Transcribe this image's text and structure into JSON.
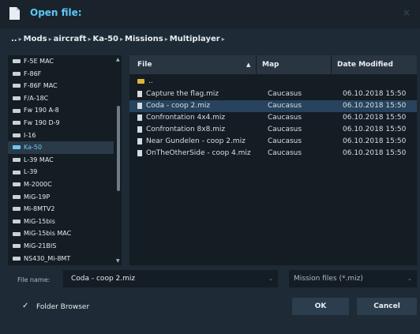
{
  "window": {
    "title": "Open file:",
    "close_glyph": "×",
    "icon": "file-icon",
    "accent_color": "#5cc8f8"
  },
  "breadcrumb": {
    "root": "..",
    "segments": [
      "Mods",
      "aircraft",
      "Ka-50",
      "Missions",
      "Multiplayer"
    ],
    "separator": "▸"
  },
  "left_list": {
    "items": [
      "F-5E MAC",
      "F-86F",
      "F-86F MAC",
      "F/A-18C",
      "Fw 190 A-8",
      "Fw 190 D-9",
      "I-16",
      "Ka-50",
      "L-39 MAC",
      "L-39",
      "M-2000C",
      "MiG-19P",
      "Mi-8MTV2",
      "MiG-15bis",
      "MiG-15bis MAC",
      "MiG-21BIS",
      "NS430_Mi-8MT"
    ],
    "selected_index": 7,
    "scroll_up_glyph": "▲",
    "scroll_down_glyph": "▼"
  },
  "table": {
    "headers": {
      "file": "File",
      "map": "Map",
      "date": "Date Modified"
    },
    "sort_glyph": "▲",
    "parent_dir": "..",
    "rows": [
      {
        "file": "Capture the flag.miz",
        "map": "Caucasus",
        "date": "06.10.2018 15:50"
      },
      {
        "file": "Coda  - coop 2.miz",
        "map": "Caucasus",
        "date": "06.10.2018 15:50"
      },
      {
        "file": "Confrontation 4x4.miz",
        "map": "Caucasus",
        "date": "06.10.2018 15:50"
      },
      {
        "file": "Confrontation 8x8.miz",
        "map": "Caucasus",
        "date": "06.10.2018 15:50"
      },
      {
        "file": "Near Gundelen - coop 2.miz",
        "map": "Caucasus",
        "date": "06.10.2018 15:50"
      },
      {
        "file": "OnTheOtherSide - coop 4.miz",
        "map": "Caucasus",
        "date": "06.10.2018 15:50"
      }
    ],
    "selected_row": 1
  },
  "file_name": {
    "label": "File name:",
    "value": "Coda  - coop 2.miz",
    "chevron": "⌄"
  },
  "filter": {
    "value": "Mission files (*.miz)",
    "chevron": "⌄"
  },
  "folder_browser": {
    "label": "Folder Browser",
    "checked": true,
    "check_glyph": "✓"
  },
  "buttons": {
    "ok": "OK",
    "cancel": "Cancel"
  }
}
